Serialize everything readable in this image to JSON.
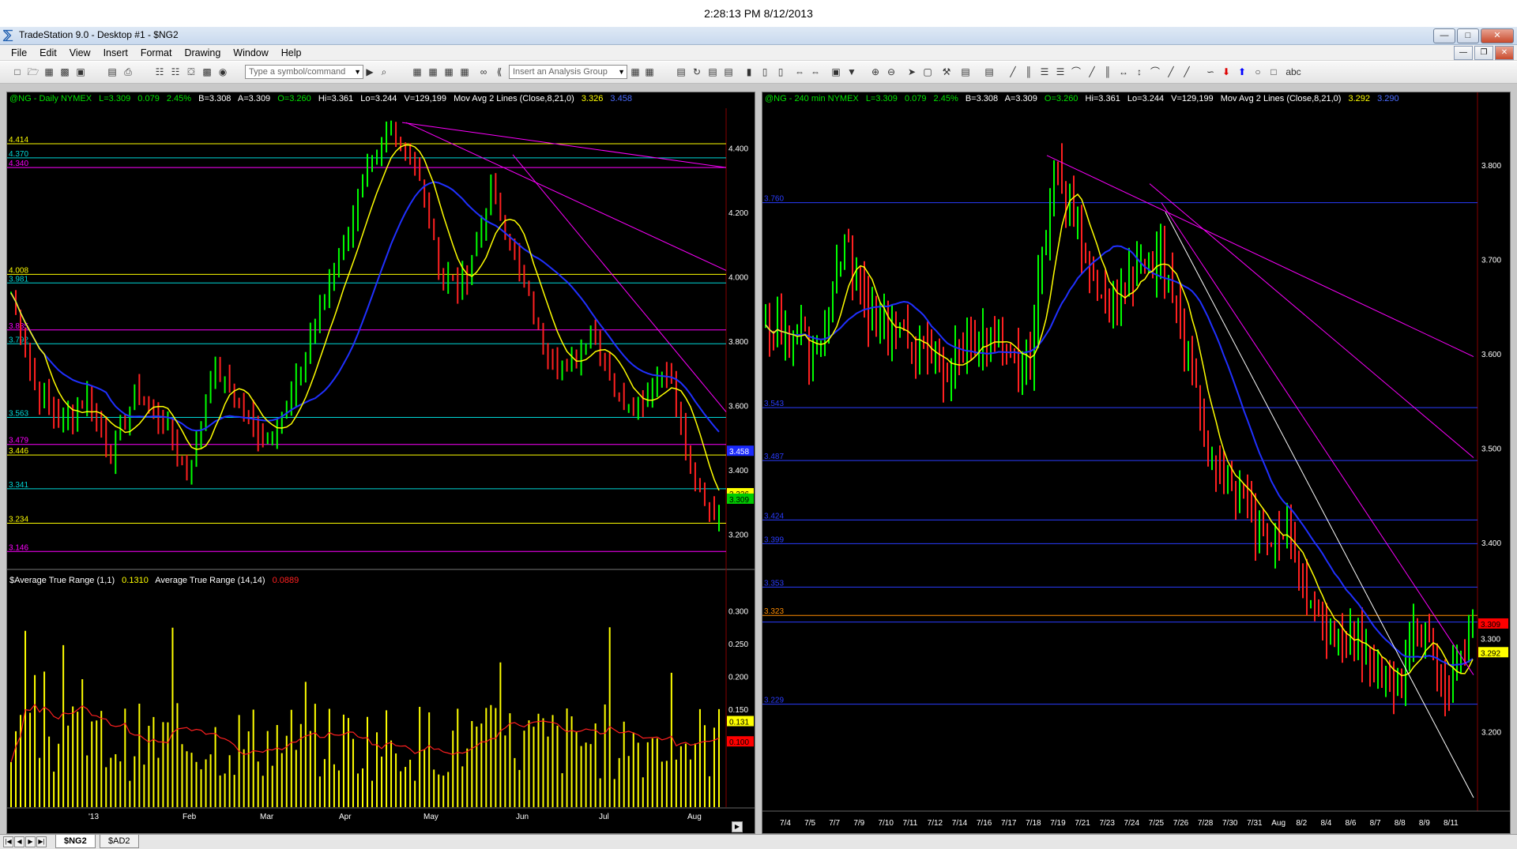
{
  "clock": "2:28:13 PM 8/12/2013",
  "window": {
    "title": "TradeStation 9.0 - Desktop #1 - $NG2"
  },
  "menu": [
    "File",
    "Edit",
    "View",
    "Insert",
    "Format",
    "Drawing",
    "Window",
    "Help"
  ],
  "toolbar": {
    "symbol_placeholder": "Type a symbol/command",
    "analysis_placeholder": "Insert an Analysis Group"
  },
  "left_chart": {
    "header": {
      "symbol": "@NG - Daily  NYMEX",
      "last": "L=3.309",
      "change": "0.079",
      "pct": "2.45%",
      "bid": "B=3.308",
      "ask": "A=3.309",
      "open": "O=3.260",
      "high": "Hi=3.361",
      "low": "Lo=3.244",
      "volume": "V=129,199",
      "study": "Mov Avg 2 Lines (Close,8,21,0)",
      "ma_fast": "3.326",
      "ma_slow": "3.458"
    },
    "atr_header": {
      "name1": "$Average True Range (1,1)",
      "v1": "0.1310",
      "name2": "Average True Range (14,14)",
      "v2": "0.0889"
    },
    "price_axis": [
      "4.400",
      "4.200",
      "4.000",
      "3.800",
      "3.600",
      "3.400",
      "3.200"
    ],
    "atr_axis": [
      "0.300",
      "0.250",
      "0.200",
      "0.150"
    ],
    "month_labels": [
      "'13",
      "Feb",
      "Mar",
      "Apr",
      "May",
      "Jun",
      "Jul",
      "Aug"
    ],
    "levels": [
      {
        "label": "4.414",
        "v": 4.414,
        "color": "#ffff00"
      },
      {
        "label": "4.370",
        "v": 4.37,
        "color": "#00d8d8"
      },
      {
        "label": "4.340",
        "v": 4.34,
        "color": "#ff00ff"
      },
      {
        "label": "4.008",
        "v": 4.008,
        "color": "#ffff00"
      },
      {
        "label": "3.981",
        "v": 3.981,
        "color": "#00d8d8"
      },
      {
        "label": "3.835",
        "v": 3.835,
        "color": "#ff00ff"
      },
      {
        "label": "3.792",
        "v": 3.792,
        "color": "#00d8d8"
      },
      {
        "label": "3.563",
        "v": 3.563,
        "color": "#00d8d8"
      },
      {
        "label": "3.479",
        "v": 3.479,
        "color": "#ff00ff"
      },
      {
        "label": "3.446",
        "v": 3.446,
        "color": "#ffff00"
      },
      {
        "label": "3.341",
        "v": 3.341,
        "color": "#00d8d8"
      },
      {
        "label": "3.234",
        "v": 3.234,
        "color": "#ffff00"
      },
      {
        "label": "3.146",
        "v": 3.146,
        "color": "#ff00ff"
      }
    ],
    "markers": {
      "ma_slow": "3.458",
      "ma_fast": "3.326",
      "last": "3.309",
      "atr_now": "0.131",
      "atr_avg": "0.100"
    }
  },
  "right_chart": {
    "header": {
      "symbol": "@NG - 240 min  NYMEX",
      "last": "L=3.309",
      "change": "0.079",
      "pct": "2.45%",
      "bid": "B=3.308",
      "ask": "A=3.309",
      "open": "O=3.260",
      "high": "Hi=3.361",
      "low": "Lo=3.244",
      "volume": "V=129,199",
      "study": "Mov Avg 2 Lines (Close,8,21,0)",
      "ma_fast": "3.292",
      "ma_slow": "3.290"
    },
    "price_axis": [
      "3.800",
      "3.700",
      "3.600",
      "3.500",
      "3.400",
      "3.300",
      "3.200"
    ],
    "date_labels": [
      "7/4",
      "7/5",
      "7/7",
      "7/9",
      "7/10",
      "7/11",
      "7/12",
      "7/14",
      "7/16",
      "7/17",
      "7/18",
      "7/19",
      "7/21",
      "7/23",
      "7/24",
      "7/25",
      "7/26",
      "7/28",
      "7/30",
      "7/31",
      "Aug",
      "8/2",
      "8/4",
      "8/6",
      "8/7",
      "8/8",
      "8/9",
      "8/11"
    ],
    "levels": [
      {
        "label": "3.760",
        "v": 3.76,
        "color": "#2a3cff"
      },
      {
        "label": "3.543",
        "v": 3.543,
        "color": "#2a3cff"
      },
      {
        "label": "3.487",
        "v": 3.487,
        "color": "#2a3cff"
      },
      {
        "label": "3.424",
        "v": 3.424,
        "color": "#2a3cff"
      },
      {
        "label": "3.399",
        "v": 3.399,
        "color": "#2a3cff"
      },
      {
        "label": "3.353",
        "v": 3.353,
        "color": "#2a3cff"
      },
      {
        "label": "3.323",
        "v": 3.323,
        "color": "#ff8c00"
      },
      {
        "label": "",
        "v": 3.316,
        "color": "#2a3cff"
      },
      {
        "label": "3.229",
        "v": 3.229,
        "color": "#2a3cff"
      }
    ],
    "markers": {
      "last": "3.309",
      "ma_slow": "3.300",
      "ma_fast": "3.292"
    }
  },
  "tabs": [
    "$NG2",
    "$AD2"
  ]
}
